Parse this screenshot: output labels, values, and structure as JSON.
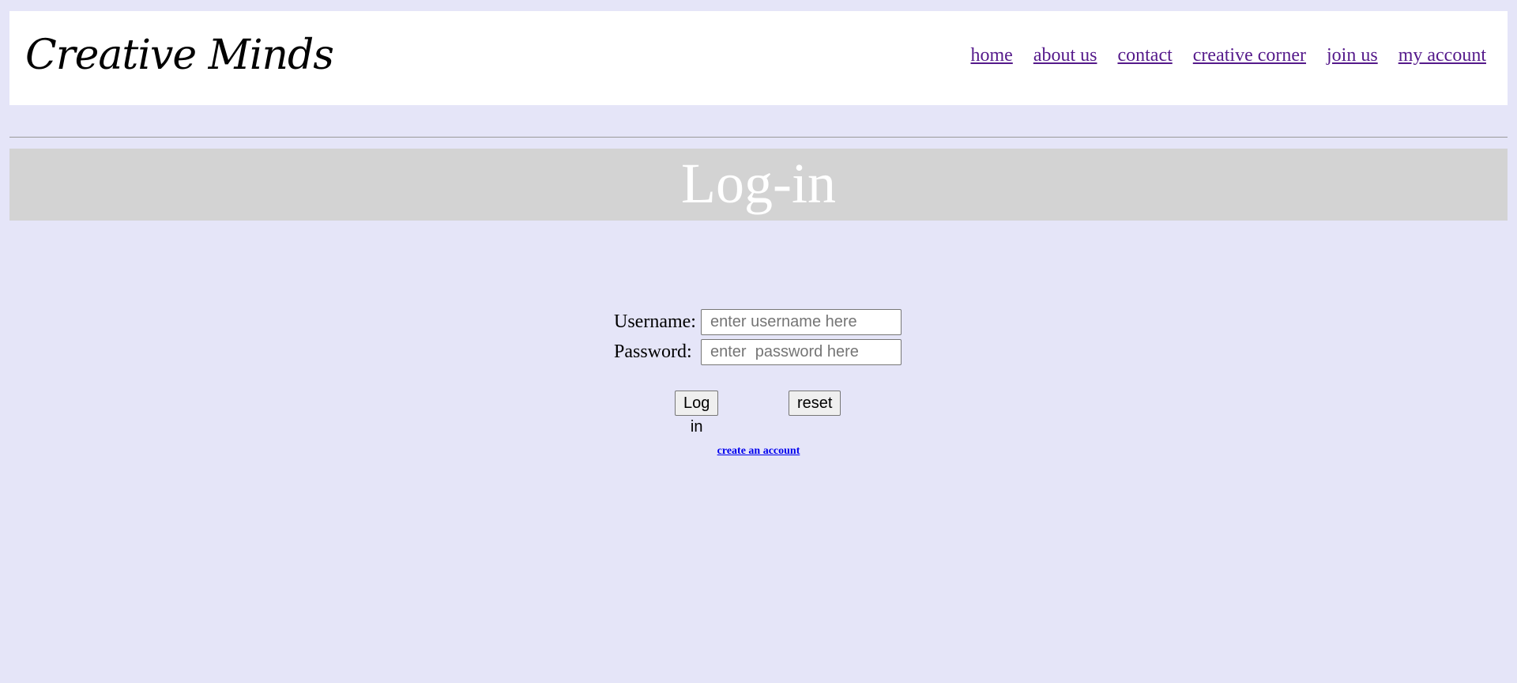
{
  "header": {
    "logo": "Creative Minds",
    "nav": [
      {
        "label": "home"
      },
      {
        "label": "about us"
      },
      {
        "label": "contact"
      },
      {
        "label": "creative corner"
      },
      {
        "label": "join us"
      },
      {
        "label": "my account"
      }
    ]
  },
  "page": {
    "title": "Log-in"
  },
  "form": {
    "username_label": "Username:",
    "username_placeholder": "enter username here",
    "password_label": "Password:",
    "password_placeholder": "enter  password here",
    "login_button": "Log in",
    "reset_button": "reset",
    "create_account_link": "create an account"
  },
  "colors": {
    "background": "#e5e5f8",
    "header_background": "#ffffff",
    "title_bar": "#d3d3d3",
    "nav_link": "#551a8b",
    "link": "#0000ee"
  }
}
